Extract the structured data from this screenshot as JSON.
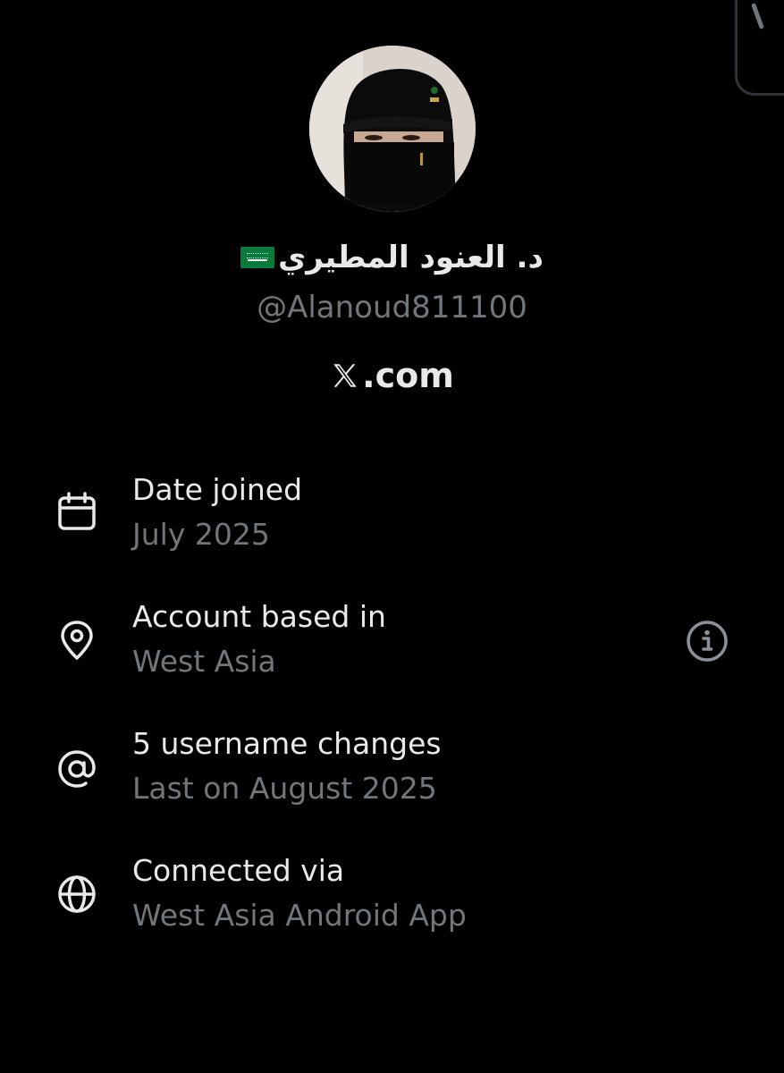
{
  "profile": {
    "name": "د. العنود المطيري",
    "flag_icon": "saudi-flag-emoji",
    "handle": "@Alanoud811100",
    "site": ".com",
    "site_logo": "x-logo"
  },
  "details": [
    {
      "icon": "calendar-icon",
      "title": "Date joined",
      "value": "July 2025"
    },
    {
      "icon": "location-pin-icon",
      "title": "Account based in",
      "value": "West Asia"
    },
    {
      "icon": "at-sign-icon",
      "title": "5 username changes",
      "value": "Last on August 2025"
    },
    {
      "icon": "globe-icon",
      "title": "Connected via",
      "value": "West Asia Android App"
    }
  ],
  "colors": {
    "background": "#000000",
    "primary_text": "#e7e9ea",
    "secondary_text": "#71767b"
  }
}
